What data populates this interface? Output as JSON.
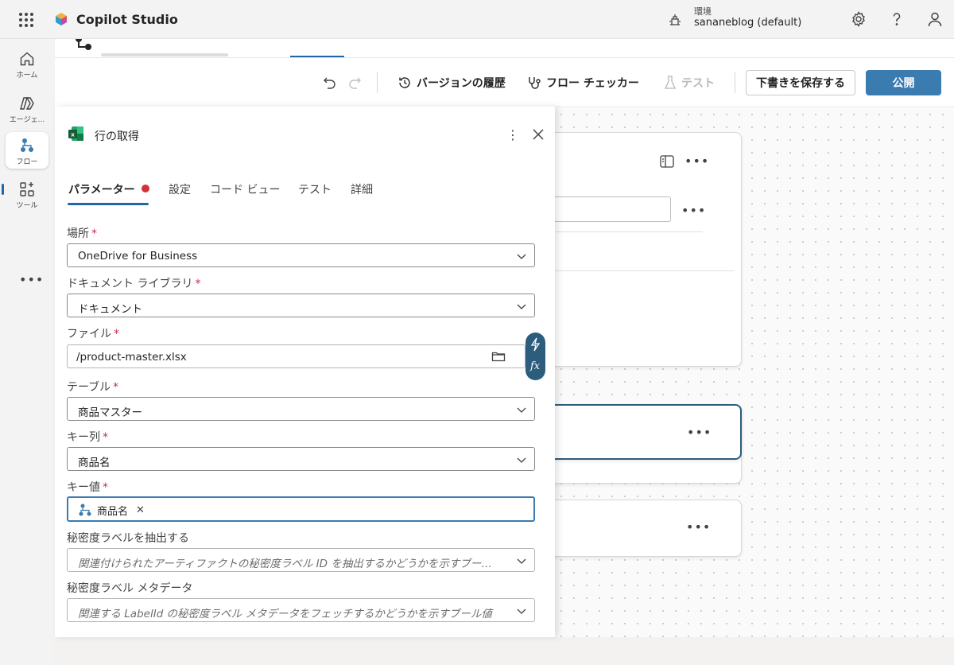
{
  "app": {
    "title": "Copilot Studio"
  },
  "environment": {
    "label": "環境",
    "value": "sananeblog (default)"
  },
  "rail": {
    "items": [
      {
        "label": "ホーム",
        "icon": "home-icon"
      },
      {
        "label": "エージェ...",
        "icon": "agents-icon"
      },
      {
        "label": "フロー",
        "icon": "flow-icon"
      },
      {
        "label": "ツール",
        "icon": "tools-icon"
      }
    ],
    "more": "•••"
  },
  "toolbar": {
    "version_history": "バージョンの履歴",
    "flow_checker": "フロー チェッカー",
    "test": "テスト",
    "save_draft": "下書きを保存する",
    "publish": "公開"
  },
  "canvas": {
    "more": "•••"
  },
  "panel": {
    "title": "行の取得",
    "more": "⋮",
    "tabs": [
      "パラメーター",
      "設定",
      "コード ビュー",
      "テスト",
      "詳細"
    ],
    "fields": {
      "location": {
        "label": "場所",
        "required": "*",
        "value": "OneDrive for Business"
      },
      "library": {
        "label": "ドキュメント ライブラリ",
        "required": "*",
        "value": "ドキュメント"
      },
      "file": {
        "label": "ファイル",
        "required": "*",
        "value": "/product-master.xlsx"
      },
      "table": {
        "label": "テーブル",
        "required": "*",
        "value": "商品マスター"
      },
      "key_column": {
        "label": "キー列",
        "required": "*",
        "value": "商品名"
      },
      "key_value": {
        "label": "キー値",
        "required": "*",
        "token": "商品名",
        "token_remove": "✕"
      },
      "sensitivity_extract": {
        "label": "秘密度ラベルを抽出する",
        "placeholder": "関連付けられたアーティファクトの秘密度ラベル ID を抽出するかどうかを示すブール値"
      },
      "sensitivity_metadata": {
        "label": "秘密度ラベル メタデータ",
        "placeholder": "関連する LabelId の秘密度ラベル メタデータをフェッチするかどうかを示すブール値"
      }
    },
    "fx_label": "fx"
  },
  "colors": {
    "accent": "#2266aa",
    "publish": "#3a7bb0",
    "required": "#c4314b",
    "error_dot": "#d13438",
    "fx_pill": "#2c5d7c"
  }
}
